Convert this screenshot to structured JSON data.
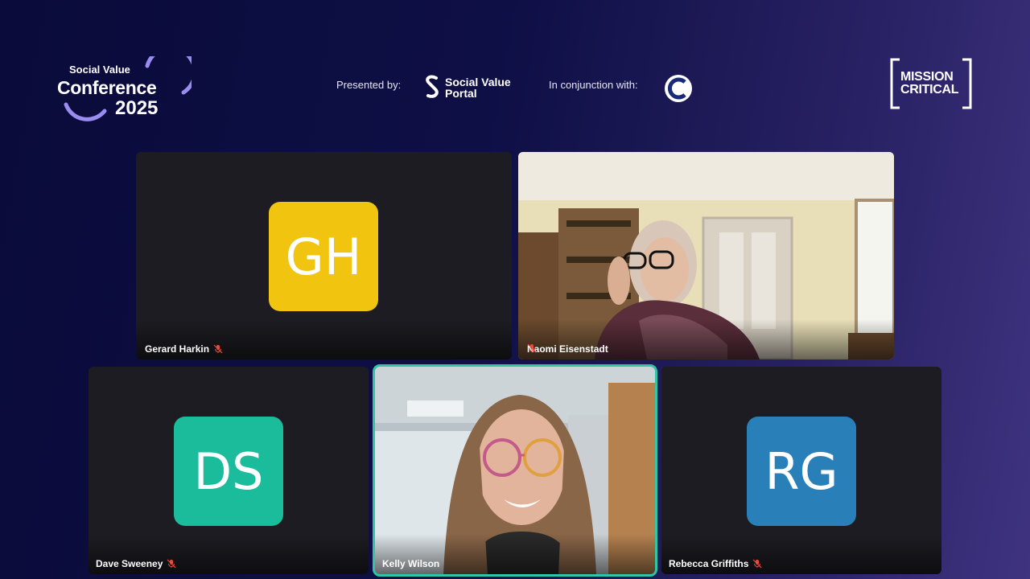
{
  "header": {
    "conference_logo": {
      "line1": "Social Value",
      "line2": "Conference",
      "line3": "2025"
    },
    "presented_by_label": "Presented by:",
    "presenter_logo": {
      "line1": "Social Value",
      "line2": "Portal"
    },
    "conjunction_label": "In conjunction with:",
    "mission_logo": {
      "line1": "MISSION",
      "line2": "CRITICAL"
    }
  },
  "participants": [
    {
      "name": "Gerard Harkin",
      "initials": "GH",
      "avatar_color": "#f1c40f",
      "muted": true,
      "video": false
    },
    {
      "name": "Naomi Eisenstadt",
      "initials": "",
      "muted": true,
      "video": true
    },
    {
      "name": "Dave Sweeney",
      "initials": "DS",
      "avatar_color": "#1abc9c",
      "muted": true,
      "video": false
    },
    {
      "name": "Kelly Wilson",
      "initials": "",
      "muted": false,
      "video": true,
      "active_speaker": true
    },
    {
      "name": "Rebecca Griffiths",
      "initials": "RG",
      "avatar_color": "#2980b9",
      "muted": true,
      "video": false
    }
  ],
  "colors": {
    "active_speaker_border": "#2fc6a6",
    "mute_icon": "#e74c3c",
    "tile_bg": "#1d1c22"
  }
}
